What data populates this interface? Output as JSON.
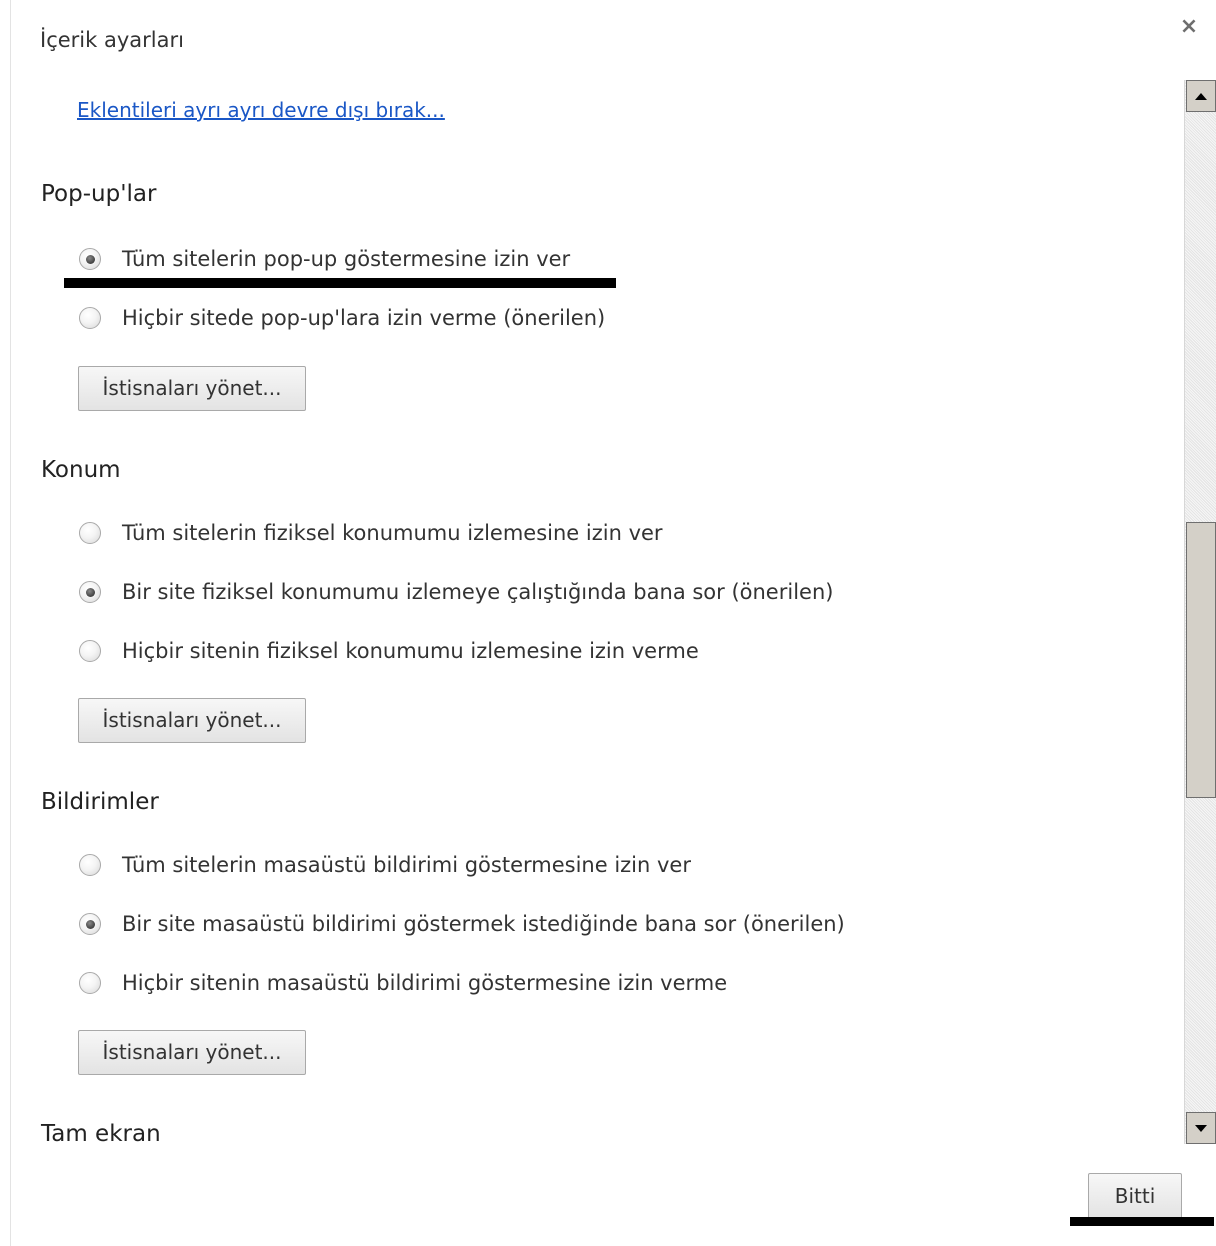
{
  "dialog": {
    "title": "İçerik ayarları",
    "close_icon": "close-icon",
    "done_label": "Bitti"
  },
  "plugins": {
    "disable_individually_link": "Eklentileri ayrı ayrı devre dışı bırak..."
  },
  "popups": {
    "title": "Pop-up'lar",
    "options": [
      {
        "label": "Tüm sitelerin pop-up göstermesine izin ver",
        "checked": true
      },
      {
        "label": "Hiçbir sitede pop-up'lara izin verme (önerilen)",
        "checked": false
      }
    ],
    "manage_label": "İstisnaları yönet..."
  },
  "location": {
    "title": "Konum",
    "options": [
      {
        "label": "Tüm sitelerin fiziksel konumumu izlemesine izin ver",
        "checked": false
      },
      {
        "label": "Bir site fiziksel konumumu izlemeye çalıştığında bana sor (önerilen)",
        "checked": true
      },
      {
        "label": "Hiçbir sitenin fiziksel konumumu izlemesine izin verme",
        "checked": false
      }
    ],
    "manage_label": "İstisnaları yönet..."
  },
  "notifications": {
    "title": "Bildirimler",
    "options": [
      {
        "label": "Tüm sitelerin masaüstü bildirimi göstermesine izin ver",
        "checked": false
      },
      {
        "label": "Bir site masaüstü bildirimi göstermek istediğinde bana sor (önerilen)",
        "checked": true
      },
      {
        "label": "Hiçbir sitenin masaüstü bildirimi göstermesine izin verme",
        "checked": false
      }
    ],
    "manage_label": "İstisnaları yönet..."
  },
  "fullscreen": {
    "title": "Tam ekran"
  }
}
